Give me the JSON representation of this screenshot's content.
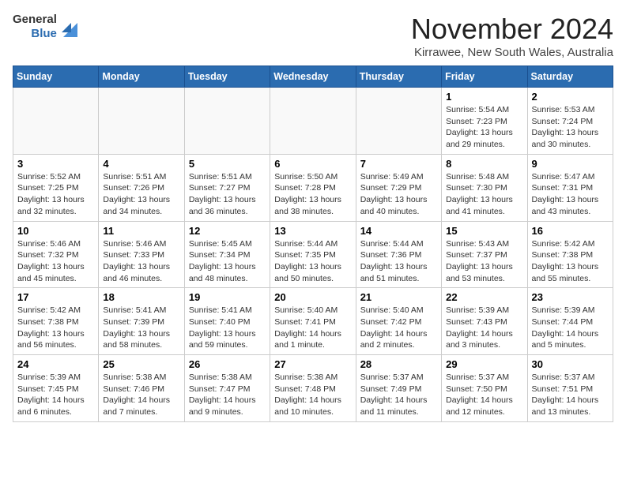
{
  "header": {
    "logo_line1": "General",
    "logo_line2": "Blue",
    "month_title": "November 2024",
    "location": "Kirrawee, New South Wales, Australia"
  },
  "weekdays": [
    "Sunday",
    "Monday",
    "Tuesday",
    "Wednesday",
    "Thursday",
    "Friday",
    "Saturday"
  ],
  "weeks": [
    [
      {
        "day": "",
        "detail": ""
      },
      {
        "day": "",
        "detail": ""
      },
      {
        "day": "",
        "detail": ""
      },
      {
        "day": "",
        "detail": ""
      },
      {
        "day": "",
        "detail": ""
      },
      {
        "day": "1",
        "detail": "Sunrise: 5:54 AM\nSunset: 7:23 PM\nDaylight: 13 hours\nand 29 minutes."
      },
      {
        "day": "2",
        "detail": "Sunrise: 5:53 AM\nSunset: 7:24 PM\nDaylight: 13 hours\nand 30 minutes."
      }
    ],
    [
      {
        "day": "3",
        "detail": "Sunrise: 5:52 AM\nSunset: 7:25 PM\nDaylight: 13 hours\nand 32 minutes."
      },
      {
        "day": "4",
        "detail": "Sunrise: 5:51 AM\nSunset: 7:26 PM\nDaylight: 13 hours\nand 34 minutes."
      },
      {
        "day": "5",
        "detail": "Sunrise: 5:51 AM\nSunset: 7:27 PM\nDaylight: 13 hours\nand 36 minutes."
      },
      {
        "day": "6",
        "detail": "Sunrise: 5:50 AM\nSunset: 7:28 PM\nDaylight: 13 hours\nand 38 minutes."
      },
      {
        "day": "7",
        "detail": "Sunrise: 5:49 AM\nSunset: 7:29 PM\nDaylight: 13 hours\nand 40 minutes."
      },
      {
        "day": "8",
        "detail": "Sunrise: 5:48 AM\nSunset: 7:30 PM\nDaylight: 13 hours\nand 41 minutes."
      },
      {
        "day": "9",
        "detail": "Sunrise: 5:47 AM\nSunset: 7:31 PM\nDaylight: 13 hours\nand 43 minutes."
      }
    ],
    [
      {
        "day": "10",
        "detail": "Sunrise: 5:46 AM\nSunset: 7:32 PM\nDaylight: 13 hours\nand 45 minutes."
      },
      {
        "day": "11",
        "detail": "Sunrise: 5:46 AM\nSunset: 7:33 PM\nDaylight: 13 hours\nand 46 minutes."
      },
      {
        "day": "12",
        "detail": "Sunrise: 5:45 AM\nSunset: 7:34 PM\nDaylight: 13 hours\nand 48 minutes."
      },
      {
        "day": "13",
        "detail": "Sunrise: 5:44 AM\nSunset: 7:35 PM\nDaylight: 13 hours\nand 50 minutes."
      },
      {
        "day": "14",
        "detail": "Sunrise: 5:44 AM\nSunset: 7:36 PM\nDaylight: 13 hours\nand 51 minutes."
      },
      {
        "day": "15",
        "detail": "Sunrise: 5:43 AM\nSunset: 7:37 PM\nDaylight: 13 hours\nand 53 minutes."
      },
      {
        "day": "16",
        "detail": "Sunrise: 5:42 AM\nSunset: 7:38 PM\nDaylight: 13 hours\nand 55 minutes."
      }
    ],
    [
      {
        "day": "17",
        "detail": "Sunrise: 5:42 AM\nSunset: 7:38 PM\nDaylight: 13 hours\nand 56 minutes."
      },
      {
        "day": "18",
        "detail": "Sunrise: 5:41 AM\nSunset: 7:39 PM\nDaylight: 13 hours\nand 58 minutes."
      },
      {
        "day": "19",
        "detail": "Sunrise: 5:41 AM\nSunset: 7:40 PM\nDaylight: 13 hours\nand 59 minutes."
      },
      {
        "day": "20",
        "detail": "Sunrise: 5:40 AM\nSunset: 7:41 PM\nDaylight: 14 hours\nand 1 minute."
      },
      {
        "day": "21",
        "detail": "Sunrise: 5:40 AM\nSunset: 7:42 PM\nDaylight: 14 hours\nand 2 minutes."
      },
      {
        "day": "22",
        "detail": "Sunrise: 5:39 AM\nSunset: 7:43 PM\nDaylight: 14 hours\nand 3 minutes."
      },
      {
        "day": "23",
        "detail": "Sunrise: 5:39 AM\nSunset: 7:44 PM\nDaylight: 14 hours\nand 5 minutes."
      }
    ],
    [
      {
        "day": "24",
        "detail": "Sunrise: 5:39 AM\nSunset: 7:45 PM\nDaylight: 14 hours\nand 6 minutes."
      },
      {
        "day": "25",
        "detail": "Sunrise: 5:38 AM\nSunset: 7:46 PM\nDaylight: 14 hours\nand 7 minutes."
      },
      {
        "day": "26",
        "detail": "Sunrise: 5:38 AM\nSunset: 7:47 PM\nDaylight: 14 hours\nand 9 minutes."
      },
      {
        "day": "27",
        "detail": "Sunrise: 5:38 AM\nSunset: 7:48 PM\nDaylight: 14 hours\nand 10 minutes."
      },
      {
        "day": "28",
        "detail": "Sunrise: 5:37 AM\nSunset: 7:49 PM\nDaylight: 14 hours\nand 11 minutes."
      },
      {
        "day": "29",
        "detail": "Sunrise: 5:37 AM\nSunset: 7:50 PM\nDaylight: 14 hours\nand 12 minutes."
      },
      {
        "day": "30",
        "detail": "Sunrise: 5:37 AM\nSunset: 7:51 PM\nDaylight: 14 hours\nand 13 minutes."
      }
    ]
  ]
}
